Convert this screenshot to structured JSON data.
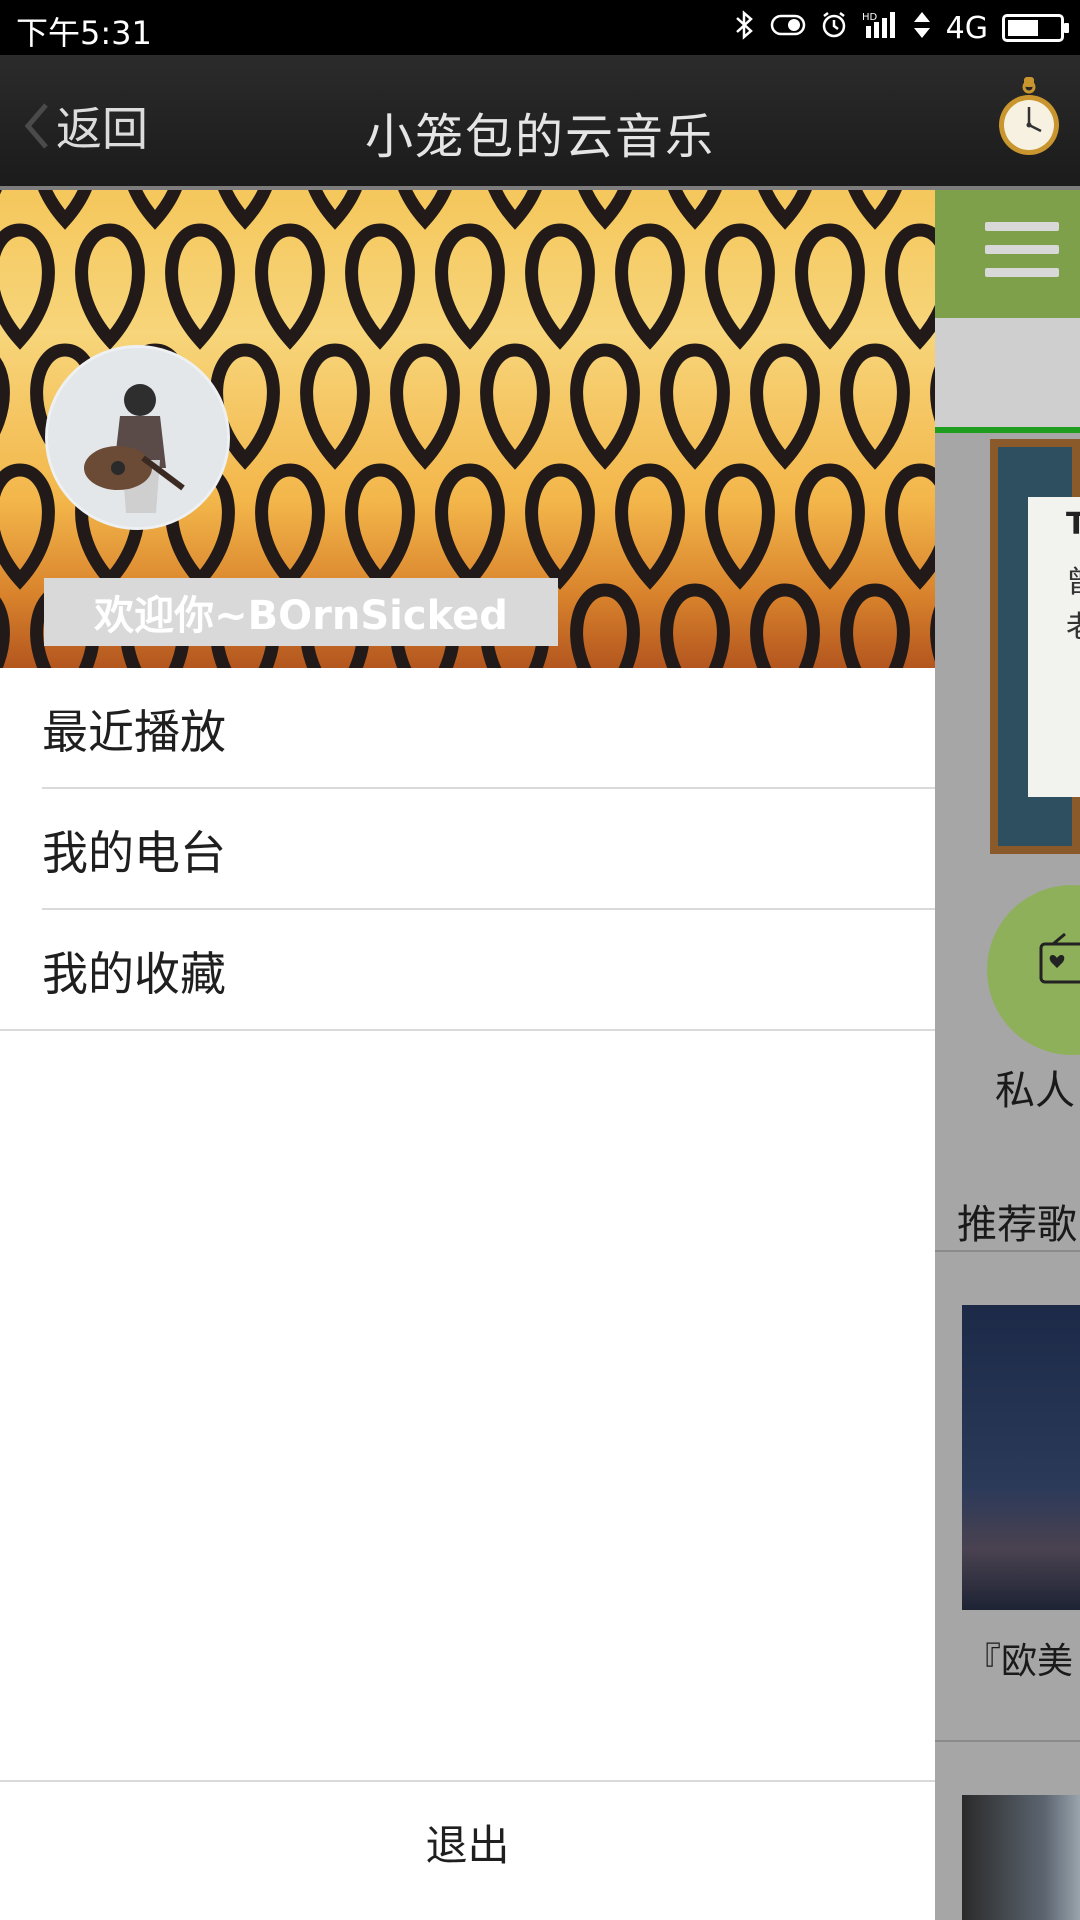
{
  "status_bar": {
    "time": "下午5:31",
    "network": "4G",
    "icons": [
      "bluetooth-icon",
      "toggle-icon",
      "alarm-icon",
      "hd-signal-icon",
      "data-arrows-icon",
      "battery-icon"
    ]
  },
  "app_bar": {
    "back_label": "返回",
    "title": "小笼包的云音乐",
    "right_icon": "pocket-watch-icon"
  },
  "drawer": {
    "welcome": "欢迎你~BOrnSicked",
    "menu_items": [
      {
        "label": "最近播放"
      },
      {
        "label": "我的电台"
      },
      {
        "label": "我的收藏"
      }
    ],
    "logout_label": "退出"
  },
  "background_peek": {
    "banner_text_1": "T",
    "banner_text_2": "曾",
    "banner_text_3": "老",
    "radio_label": "私人",
    "section_title": "推荐歌",
    "playlist_caption": "『欧美",
    "colors": {
      "accent_green": "#7fa04a",
      "tab_underline": "#1f9d1f"
    }
  }
}
